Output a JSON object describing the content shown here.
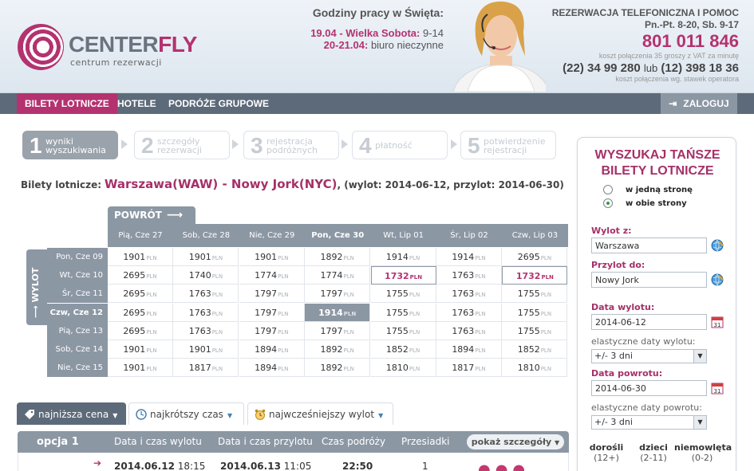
{
  "header": {
    "logo": {
      "name_part1": "CENTER",
      "name_part2": "FLY",
      "tagline": "centrum rezerwacji"
    },
    "hours": {
      "title": "Godziny pracy w Święta:",
      "line1_date": "19.04 - Wielka Sobota:",
      "line1_time": "9-14",
      "line2_date": "20-21.04:",
      "line2_text": "biuro nieczynne"
    },
    "contact": {
      "title": "REZERWACJA TELEFONICZNA I POMOC",
      "hours": "Pn.-Pt. 8-20, Sb. 9-17",
      "phone": "801 011 846",
      "phone_note": "koszt połączenia 35 groszy z VAT za minutę",
      "phone2a": "(22) 34 99 280",
      "phone2_or": "lub",
      "phone2b": "(12) 398 18 36",
      "phone2_note": "koszt połączenia wg. stawek operatora"
    }
  },
  "nav": {
    "items": [
      "BILETY LOTNICZE",
      "HOTELE",
      "PODRÓŻE GRUPOWE"
    ],
    "login": "ZALOGUJ"
  },
  "steps": [
    {
      "num": "1",
      "l1": "wyniki",
      "l2": "wyszukiwania"
    },
    {
      "num": "2",
      "l1": "szczegóły",
      "l2": "rezerwacji"
    },
    {
      "num": "3",
      "l1": "rejestracja",
      "l2": "podróżnych"
    },
    {
      "num": "4",
      "l1": "płatność",
      "l2": ""
    },
    {
      "num": "5",
      "l1": "potwierdzenie",
      "l2": "rejestracji"
    }
  ],
  "route": {
    "label": "Bilety lotnicze:",
    "from": "Warszawa(WAW)",
    "sep": " - ",
    "to": "Nowy Jork(NYC)",
    "dates": ", (wylot: 2014-06-12, przylot: 2014-06-30)"
  },
  "matrix": {
    "return_label": "POWRÓT",
    "depart_label": "WYLOT",
    "currency": "PLN",
    "return_dates": [
      "Pią, Cze 27",
      "Sob, Cze 28",
      "Nie, Cze 29",
      "Pon, Cze 30",
      "Wt, Lip 01",
      "Śr, Lip 02",
      "Czw, Lip 03"
    ],
    "depart_dates": [
      "Pon, Cze 09",
      "Wt, Cze 10",
      "Śr, Cze 11",
      "Czw, Cze 12",
      "Pią, Cze 13",
      "Sob, Cze 14",
      "Nie, Cze 15"
    ],
    "prices": [
      [
        "1901",
        "1901",
        "1901",
        "1892",
        "1914",
        "1914",
        "2695"
      ],
      [
        "2695",
        "1740",
        "1774",
        "1774",
        "1732",
        "1763",
        "1732"
      ],
      [
        "2695",
        "1763",
        "1797",
        "1797",
        "1755",
        "1763",
        "1755"
      ],
      [
        "2695",
        "1763",
        "1797",
        "1914",
        "1755",
        "1763",
        "1755"
      ],
      [
        "2695",
        "1763",
        "1797",
        "1797",
        "1755",
        "1763",
        "1755"
      ],
      [
        "1901",
        "1901",
        "1894",
        "1892",
        "1852",
        "1894",
        "1852"
      ],
      [
        "1901",
        "1817",
        "1894",
        "1892",
        "1810",
        "1817",
        "1810"
      ]
    ]
  },
  "sort_tabs": [
    "najniższa cena",
    "najkrótszy czas",
    "najwcześniejszy wylot"
  ],
  "results": {
    "option": "opcja 1",
    "columns": [
      "Data i czas wylotu",
      "Data i czas przylotu",
      "Czas podróży",
      "Przesiadki"
    ],
    "details_button": "pokaż szczegóły",
    "row": {
      "dep_date": "2014.06.12",
      "dep_time": "18:15",
      "arr_date": "2014.06.13",
      "arr_time": "11:05",
      "duration": "22:50",
      "stops": "1"
    }
  },
  "sidebar": {
    "title1": "WYSZUKAJ TAŃSZE",
    "title2": "BILETY LOTNICZE",
    "oneway": "w jedną stronę",
    "roundtrip": "w obie strony",
    "from_label": "Wylot z:",
    "from_value": "Warszawa",
    "to_label": "Przylot do:",
    "to_value": "Nowy Jork",
    "dep_label": "Data wylotu:",
    "dep_value": "2014-06-12",
    "flex_dep_label": "elastyczne daty wylotu:",
    "flex_dep_value": "+/- 3 dni",
    "ret_label": "Data powrotu:",
    "ret_value": "2014-06-30",
    "flex_ret_label": "elastyczne daty powrotu:",
    "flex_ret_value": "+/- 3 dni",
    "adults": "dorośli",
    "adults_age": "(12+)",
    "children": "dzieci",
    "children_age": "(2-11)",
    "infants": "niemowlęta",
    "infants_age": "(0-2)"
  },
  "colors": {
    "accent": "#b43270",
    "nav": "#5d6a79",
    "panel": "#8c97a4"
  }
}
